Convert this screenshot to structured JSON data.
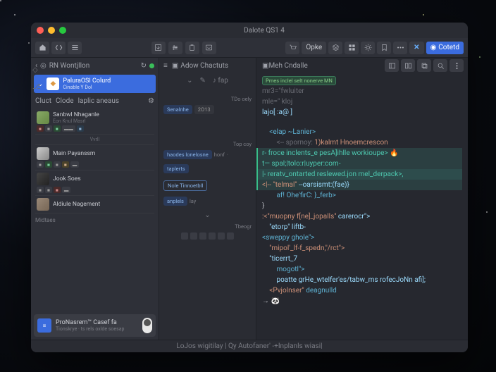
{
  "window": {
    "title": "Dalote QS1 4"
  },
  "toolbar": {
    "opke": "Opke",
    "cotetd": "Cotetd"
  },
  "sidebar": {
    "header": "RN Wontjllon",
    "selected": {
      "title": "PaluraOSI Colurd",
      "sub": "Cinable Y Dol"
    },
    "filters": [
      "Cluct",
      "Clode",
      "laplic aneaus"
    ],
    "users": [
      {
        "name": "Sanbwl Nhaganle",
        "sub": "Eon  Knul  Masrl"
      },
      {
        "name": "Vvrll",
        "sub": ""
      },
      {
        "name": "Main Payanssm",
        "sub": ""
      },
      {
        "name": "Jook Soes",
        "sub": ""
      },
      {
        "name": "Aldiule Nagement",
        "sub": ""
      }
    ],
    "section": "Midtaes",
    "card": {
      "title": "ProNasrem™ Casef fa",
      "sub": "Tionskrye · ts rels oxlde soesap"
    }
  },
  "mid": {
    "tab": "Adow Chactuts",
    "tool": "fap",
    "labels": {
      "tdo": "TDo oely",
      "top": "Top coy",
      "tbeog": "Tbeogr"
    },
    "pills": {
      "senalshe": "Senalnhe",
      "y2013": "2O13",
      "haodes": "haodes lonelosne",
      "honf": "honf",
      "taplerts": "taplerts",
      "nole": "Nole Tinnoetbll",
      "anplels": "anplels",
      "lay": "lay"
    }
  },
  "editor": {
    "tab": "Meh Cndalle",
    "code": {
      "l1": "mr3=\"fwluiter",
      "l2": "mle=\" kloj",
      "l3": "lajo[ :a@ ]",
      "l4": "<elap ~Lanier>",
      "l5c": "<-- spornoy: ",
      "l5s": "1)kalmt Hnoemcrescon",
      "l6": "r- froce inclents_e pesA]ihlle workioupe>",
      "l7": "t— spal;|tolo:r|uyper:com-",
      "l8": "|- reratv_ontarted reslewed.jon mel_derpack>,",
      "l9a": "<|-- \"telmal\"",
      "l9b": "--oarsismt:(fae)} ",
      "l9e": "🔥",
      "l10": "af! Ohe'firC: }_ferb>",
      "l11": "}",
      "l12a": ":<\"muopny f[ne]_jopalls\"",
      "l12b": " carerocr\">",
      "l13": "\"etorp\" liftb-",
      "l14": "<sweppy ghole\">",
      "l15": "\"mipol'_lf-f_spedn,\"/rct\">",
      "l16": "\"ticerrt_7",
      "l17": "mogotl\">",
      "l18": "poatte grHe_wtelfer'es/tabw_ms rofecJoNn afi];",
      "l19a": "<Pvjolnser\"",
      "l19b": " deagnulld",
      "l20": "→ 🐼"
    },
    "tag": "Pmes inclel selt nonerve MN"
  },
  "status": "LoJos wigitilay | Qy Autofaner' -+Inplanls wiasi|"
}
